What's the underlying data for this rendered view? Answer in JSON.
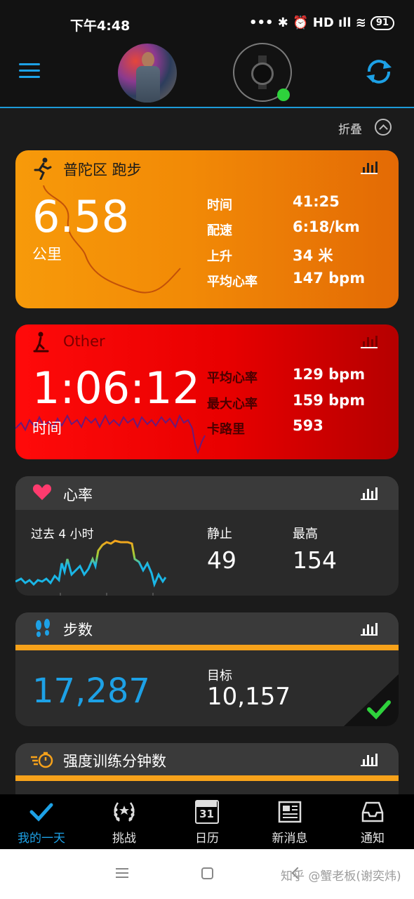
{
  "status": {
    "time": "下午4:48",
    "icons": "••• ✱ ⏰ HD ıll ≋",
    "battery": "91"
  },
  "header": {
    "menu_icon": "hamburger-menu-icon",
    "watch_status_color": "#2ed23c",
    "sync_icon": "sync-icon",
    "accent": "#1da1e6"
  },
  "fold": {
    "label": "折叠"
  },
  "run": {
    "title": "普陀区 跑步",
    "distance": "6.58",
    "unit": "公里",
    "stats": [
      {
        "key": "时间",
        "value": "41:25"
      },
      {
        "key": "配速",
        "value": "6:18/km"
      },
      {
        "key": "上升",
        "value": "34 米"
      },
      {
        "key": "平均心率",
        "value": "147 bpm"
      }
    ]
  },
  "other": {
    "title": "Other",
    "duration": "1:06:12",
    "unit": "时间",
    "stats": [
      {
        "key": "平均心率",
        "value": "129 bpm"
      },
      {
        "key": "最大心率",
        "value": "159 bpm"
      },
      {
        "key": "卡路里",
        "value": "593"
      }
    ]
  },
  "heart_rate": {
    "title": "心率",
    "period": "过去 4 小时",
    "resting_label": "静止",
    "resting_value": "49",
    "max_label": "最高",
    "max_value": "154"
  },
  "steps": {
    "title": "步数",
    "count": "17,287",
    "goal_label": "目标",
    "goal_value": "10,157"
  },
  "intensity": {
    "title": "强度训练分钟数"
  },
  "nav": [
    {
      "label": "我的一天",
      "icon": "check-icon"
    },
    {
      "label": "挑战",
      "icon": "laurel-icon"
    },
    {
      "label": "日历",
      "icon": "calendar-icon",
      "day": "31"
    },
    {
      "label": "新消息",
      "icon": "newspaper-icon"
    },
    {
      "label": "通知",
      "icon": "inbox-icon"
    }
  ],
  "watermark": "知乎 @蟹老板(谢奕炜)"
}
